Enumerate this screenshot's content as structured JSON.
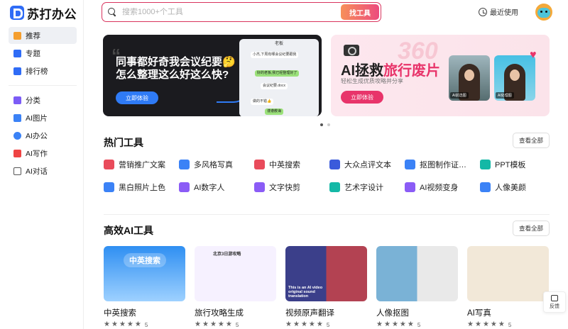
{
  "app": {
    "name": "苏打办公"
  },
  "search": {
    "placeholder": "搜索1000+个工具",
    "button": "找工具"
  },
  "header": {
    "recent": "最近使用"
  },
  "sidebar": {
    "items": [
      {
        "label": "推荐",
        "color": "#f59e2e"
      },
      {
        "label": "专题",
        "color": "#2f6cf6"
      },
      {
        "label": "排行榜",
        "color": "#2f6cf6"
      },
      {
        "label": "分类",
        "color": "#7c5cf6"
      },
      {
        "label": "AI图片",
        "color": "#3b82f6"
      },
      {
        "label": "AI办公",
        "color": "#3b82f6"
      },
      {
        "label": "AI写作",
        "color": "#ef4444"
      },
      {
        "label": "AI对话",
        "color": "#555555"
      }
    ]
  },
  "banners": [
    {
      "title": "同事都好奇我会议纪要🤔怎么整理这么好这么快?",
      "button": "立即体验",
      "chat_title": "老板",
      "messages": [
        "小杰,下周有哪会议纪要跟我",
        "好的老板,我已经整理好了",
        "会议纪要.docx",
        "做的不错👍",
        "谨遵教诲"
      ]
    },
    {
      "title_a": "AI拯救",
      "title_b": "旅行废片",
      "subtitle": "轻松生成优质攻略并分享",
      "button": "立即体验",
      "bg_text": "360",
      "tags": [
        "AI前选图",
        "AI处理图"
      ]
    }
  ],
  "hot_tools": {
    "title": "热门工具",
    "see_all": "查看全部",
    "items": [
      {
        "label": "营销推广文案",
        "color": "#e94b5b"
      },
      {
        "label": "多风格写真",
        "color": "#3b82f6"
      },
      {
        "label": "中英搜索",
        "color": "#e94b5b"
      },
      {
        "label": "大众点评文本",
        "color": "#3b5bdb"
      },
      {
        "label": "抠图制作证…",
        "color": "#3b82f6"
      },
      {
        "label": "PPT模板",
        "color": "#14b8a6"
      },
      {
        "label": "黑白照片上色",
        "color": "#3b82f6"
      },
      {
        "label": "AI数字人",
        "color": "#8b5cf6"
      },
      {
        "label": "文字快剪",
        "color": "#8b5cf6"
      },
      {
        "label": "艺术字设计",
        "color": "#14b8a6"
      },
      {
        "label": "AI视频变身",
        "color": "#8b5cf6"
      },
      {
        "label": "人像美颜",
        "color": "#3b82f6"
      }
    ]
  },
  "ai_tools": {
    "title": "高效AI工具",
    "see_all": "查看全部",
    "cards": [
      {
        "title": "中英搜索",
        "rating": "5",
        "img_label": "中英搜索"
      },
      {
        "title": "旅行攻略生成",
        "rating": "5",
        "img_label": "北京3日游攻略"
      },
      {
        "title": "视频原声翻译",
        "rating": "5",
        "img_label": "This is an AI video original sound translation"
      },
      {
        "title": "人像抠图",
        "rating": "5",
        "img_label": ""
      },
      {
        "title": "AI写真",
        "rating": "5",
        "img_label": ""
      }
    ]
  },
  "feedback": {
    "label": "反馈"
  },
  "carousel": {
    "count": 2,
    "active": 0
  }
}
